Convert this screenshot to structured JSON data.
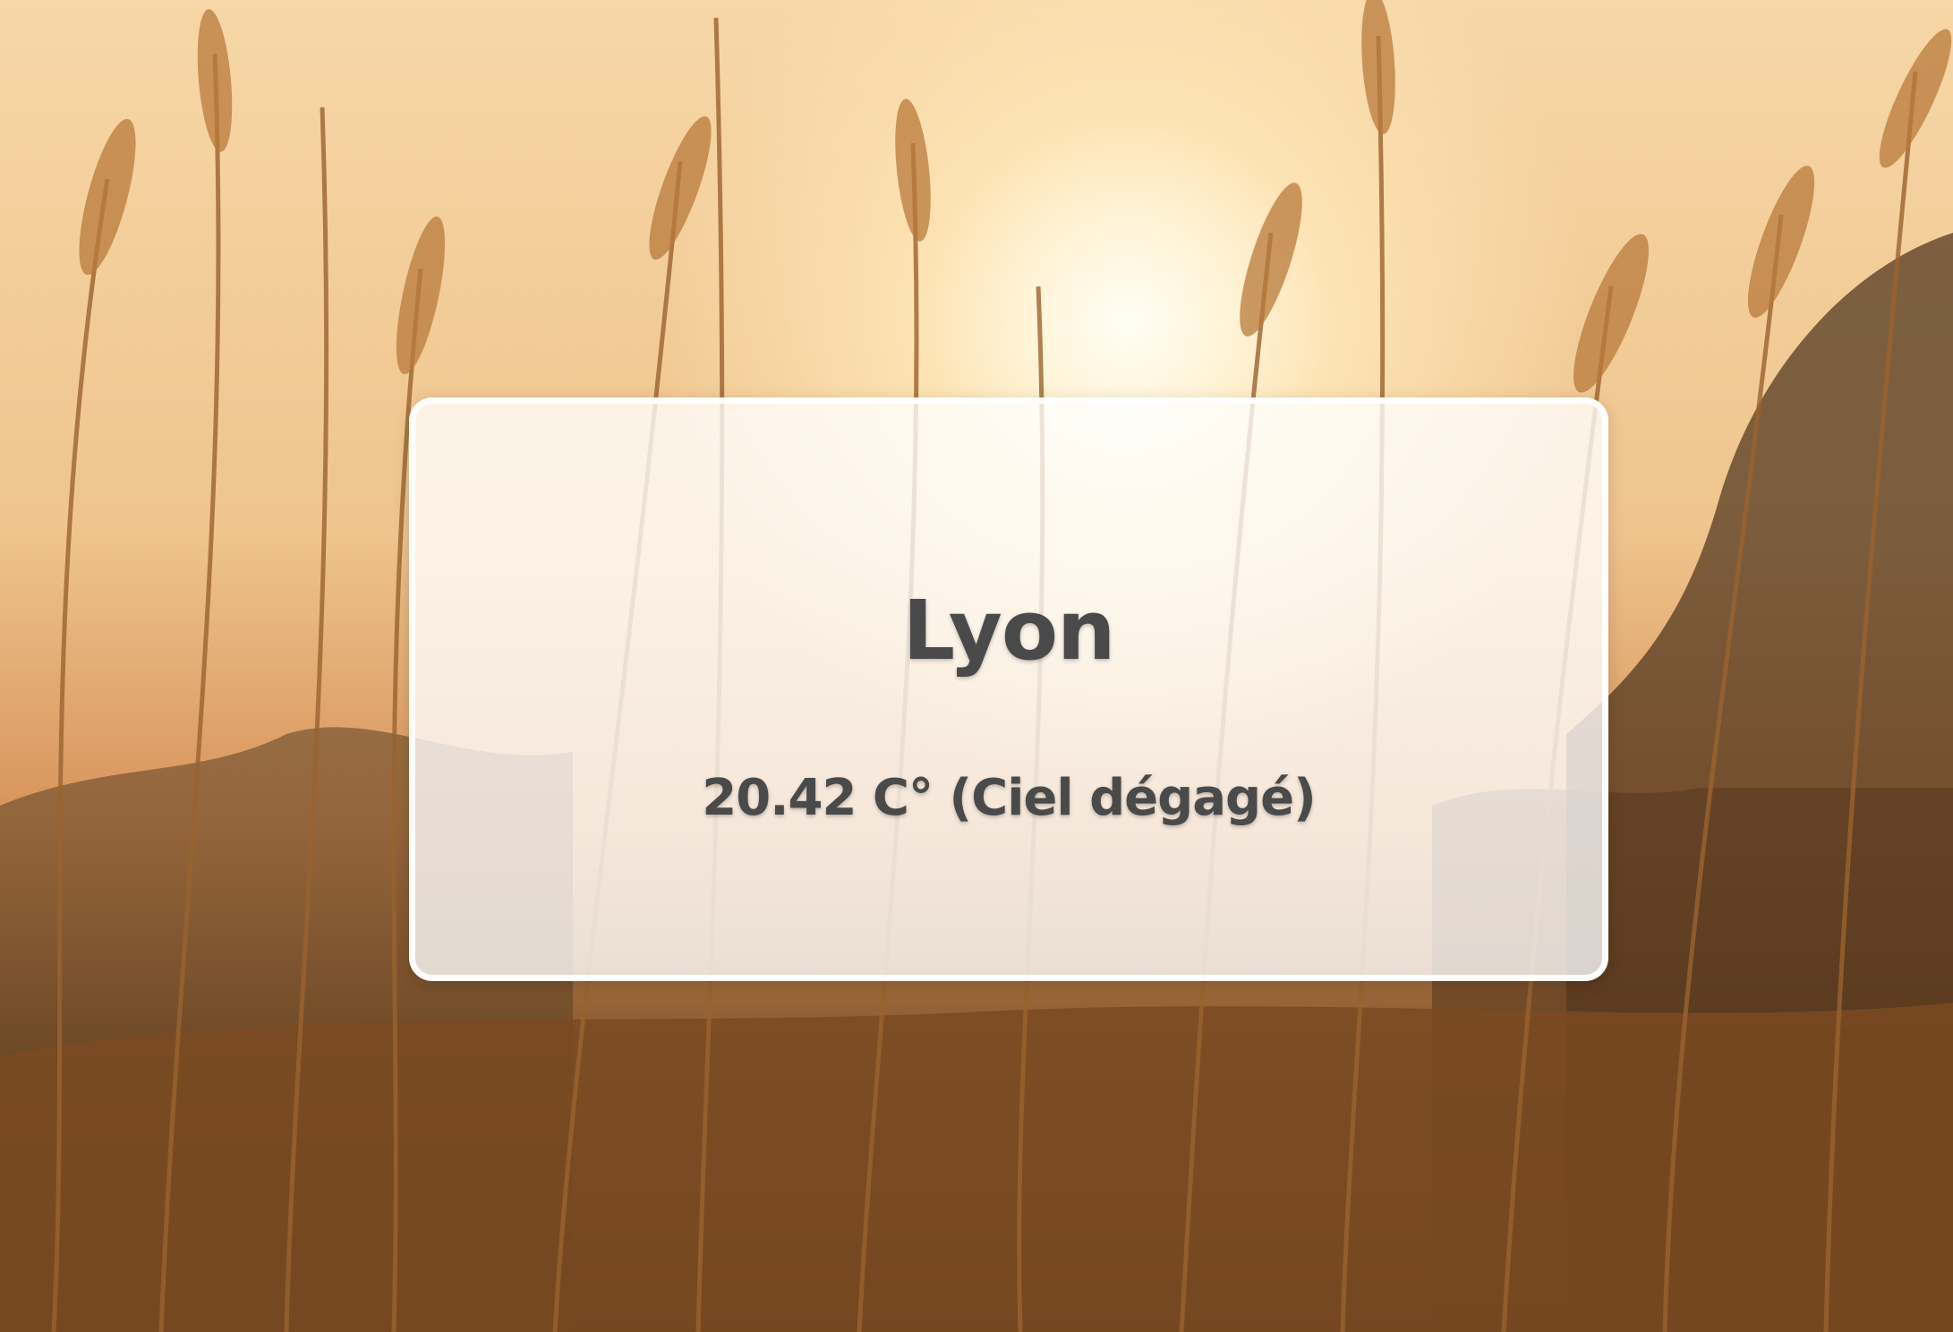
{
  "weather": {
    "city": "Lyon",
    "temperature": "20.42",
    "unit": "C°",
    "description": "Ciel dégagé"
  }
}
